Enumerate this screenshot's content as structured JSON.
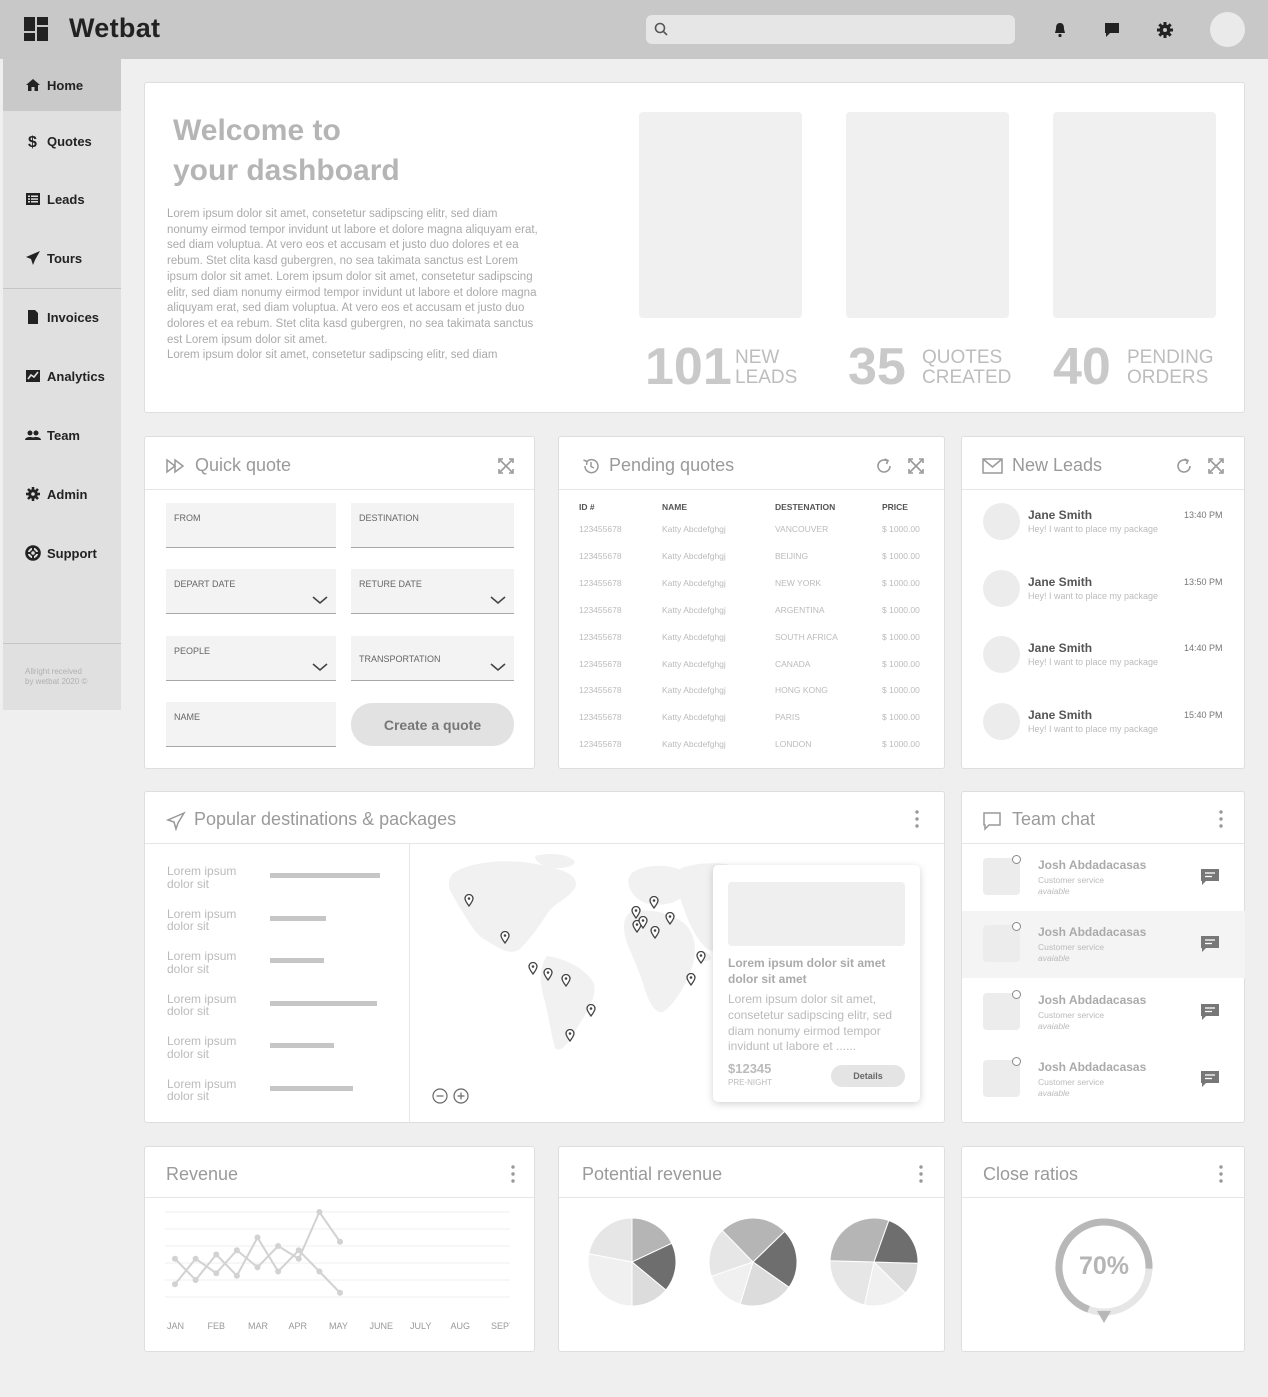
{
  "app": {
    "brand": "Wetbat"
  },
  "header": {
    "search_placeholder": ""
  },
  "sidebar": {
    "items": [
      {
        "label": "Home",
        "icon": "home-icon"
      },
      {
        "label": "Quotes",
        "icon": "dollar-icon"
      },
      {
        "label": "Leads",
        "icon": "list-icon"
      },
      {
        "label": "Tours",
        "icon": "paper-plane-icon"
      },
      {
        "label": "Invoices",
        "icon": "document-icon"
      },
      {
        "label": "Analytics",
        "icon": "chart-icon"
      },
      {
        "label": "Team",
        "icon": "team-icon"
      },
      {
        "label": "Admin",
        "icon": "gear-icon"
      },
      {
        "label": "Support",
        "icon": "lifebuoy-icon"
      }
    ],
    "copyright_line1": "Allright received",
    "copyright_line2": "by wetbat 2020 ©"
  },
  "welcome": {
    "title_line1": "Welcome to",
    "title_line2": "your dashboard",
    "body": "Lorem ipsum dolor sit amet, consetetur sadipscing elitr, sed diam nonumy eirmod tempor invidunt ut labore et dolore magna aliquyam erat, sed diam voluptua. At vero eos et accusam et justo duo dolores et ea rebum. Stet clita kasd gubergren, no sea takimata sanctus est Lorem ipsum dolor sit amet. Lorem ipsum dolor sit amet, consetetur sadipscing elitr, sed diam nonumy eirmod tempor invidunt ut labore et dolore magna aliquyam erat, sed diam voluptua. At vero eos et accusam et justo duo dolores et ea rebum. Stet clita kasd gubergren, no sea takimata sanctus est Lorem ipsum dolor sit amet.",
    "body2": "Lorem ipsum dolor sit amet, consetetur sadipscing elitr, sed diam",
    "stats": [
      {
        "value": "101",
        "label1": "NEW",
        "label2": "LEADS"
      },
      {
        "value": "35",
        "label1": "QUOTES",
        "label2": "CREATED"
      },
      {
        "value": "40",
        "label1": "PENDING",
        "label2": "ORDERS"
      }
    ]
  },
  "quick_quote": {
    "title": "Quick quote",
    "fields": {
      "from": "FROM",
      "destination": "DESTINATION",
      "depart_date": "DEPART DATE",
      "return_date": "RETURE DATE",
      "people": "PEOPLE",
      "transportation": "TRANSPORTATION",
      "name": "NAME"
    },
    "submit_label": "Create a quote"
  },
  "pending_quotes": {
    "title": "Pending quotes",
    "columns": [
      "ID #",
      "NAME",
      "DESTENATION",
      "PRICE"
    ],
    "rows": [
      [
        "123455678",
        "Katty Abcdefghgj",
        "VANCOUVER",
        "$ 1000.00"
      ],
      [
        "123455678",
        "Katty Abcdefghgj",
        "BEIJING",
        "$ 1000.00"
      ],
      [
        "123455678",
        "Katty Abcdefghgj",
        "NEW YORK",
        "$ 1000.00"
      ],
      [
        "123455678",
        "Katty Abcdefghgj",
        "ARGENTINA",
        "$ 1000.00"
      ],
      [
        "123455678",
        "Katty Abcdefghgj",
        "SOUTH AFRICA",
        "$ 1000.00"
      ],
      [
        "123455678",
        "Katty Abcdefghgj",
        "CANADA",
        "$ 1000.00"
      ],
      [
        "123455678",
        "Katty Abcdefghgj",
        "HONG KONG",
        "$ 1000.00"
      ],
      [
        "123455678",
        "Katty Abcdefghgj",
        "PARIS",
        "$ 1000.00"
      ],
      [
        "123455678",
        "Katty Abcdefghgj",
        "LONDON",
        "$ 1000.00"
      ]
    ]
  },
  "new_leads": {
    "title": "New Leads",
    "items": [
      {
        "name": "Jane Smith",
        "message": "Hey! I want to place my package",
        "time": "13:40 PM"
      },
      {
        "name": "Jane Smith",
        "message": "Hey! I want to place my package",
        "time": "13:50 PM"
      },
      {
        "name": "Jane Smith",
        "message": "Hey! I want to place my package",
        "time": "14:40 PM"
      },
      {
        "name": "Jane Smith",
        "message": "Hey! I want to place my package",
        "time": "15:40 PM"
      }
    ]
  },
  "popular": {
    "title": "Popular destinations & packages",
    "items": [
      {
        "line1": "Lorem ipsum",
        "line2": "dolor sit",
        "value": 0.92
      },
      {
        "line1": "Lorem ipsum",
        "line2": "dolor sit",
        "value": 0.47
      },
      {
        "line1": "Lorem ipsum",
        "line2": "dolor sit",
        "value": 0.45
      },
      {
        "line1": "Lorem ipsum",
        "line2": "dolor sit",
        "value": 0.89
      },
      {
        "line1": "Lorem ipsum",
        "line2": "dolor sit",
        "value": 0.53
      },
      {
        "line1": "Lorem ipsum",
        "line2": "dolor sit",
        "value": 0.69
      }
    ],
    "popup": {
      "title_line1": "Lorem ipsum dolor sit amet",
      "title_line2": "dolor sit amet",
      "body_lines": [
        "Lorem ipsum dolor sit amet,",
        "consetetur sadipscing elitr, sed",
        "diam nonumy eirmod tempor",
        "invidunt ut labore et ......"
      ],
      "price": "$12345",
      "price_unit": "PRE-NIGHT",
      "details_label": "Details"
    }
  },
  "team_chat": {
    "title": "Team chat",
    "members": [
      {
        "name": "Josh Abdadacasas",
        "role": "Customer service",
        "status": "avaiable"
      },
      {
        "name": "Josh Abdadacasas",
        "role": "Customer service",
        "status": "avaiable"
      },
      {
        "name": "Josh Abdadacasas",
        "role": "Customer service",
        "status": "avaiable"
      },
      {
        "name": "Josh Abdadacasas",
        "role": "Customer service",
        "status": "avaiable"
      }
    ]
  },
  "revenue": {
    "title": "Revenue"
  },
  "potential_revenue": {
    "title": "Potential revenue"
  },
  "close_ratios": {
    "title": "Close ratios",
    "value_label": "70%",
    "value": 0.7
  },
  "chart_data": [
    {
      "type": "line",
      "title": "Revenue",
      "categories": [
        "JAN",
        "FEB",
        "MAR",
        "APR",
        "MAY",
        "JUNE",
        "JULY",
        "AUG",
        "SEPT"
      ],
      "series": [
        {
          "values": [
            0.15,
            0.45,
            0.28,
            0.55,
            0.35,
            0.6,
            0.45,
            1.0,
            0.65
          ]
        },
        {
          "values": [
            0.45,
            0.2,
            0.5,
            0.25,
            0.7,
            0.3,
            0.55,
            0.3,
            0.05
          ]
        }
      ],
      "grid": true
    },
    {
      "type": "pie",
      "title": "Potential revenue",
      "pies": [
        [
          0.18,
          0.18,
          0.14,
          0.28,
          0.22
        ],
        [
          0.22,
          0.2,
          0.15,
          0.18,
          0.25
        ],
        [
          0.12,
          0.16,
          0.22,
          0.3,
          0.2
        ]
      ],
      "colors": [
        "#b5b5b5",
        "#6e6e6e",
        "#dcdcdc",
        "#f0f0f0",
        "#e6e6e6"
      ]
    }
  ]
}
